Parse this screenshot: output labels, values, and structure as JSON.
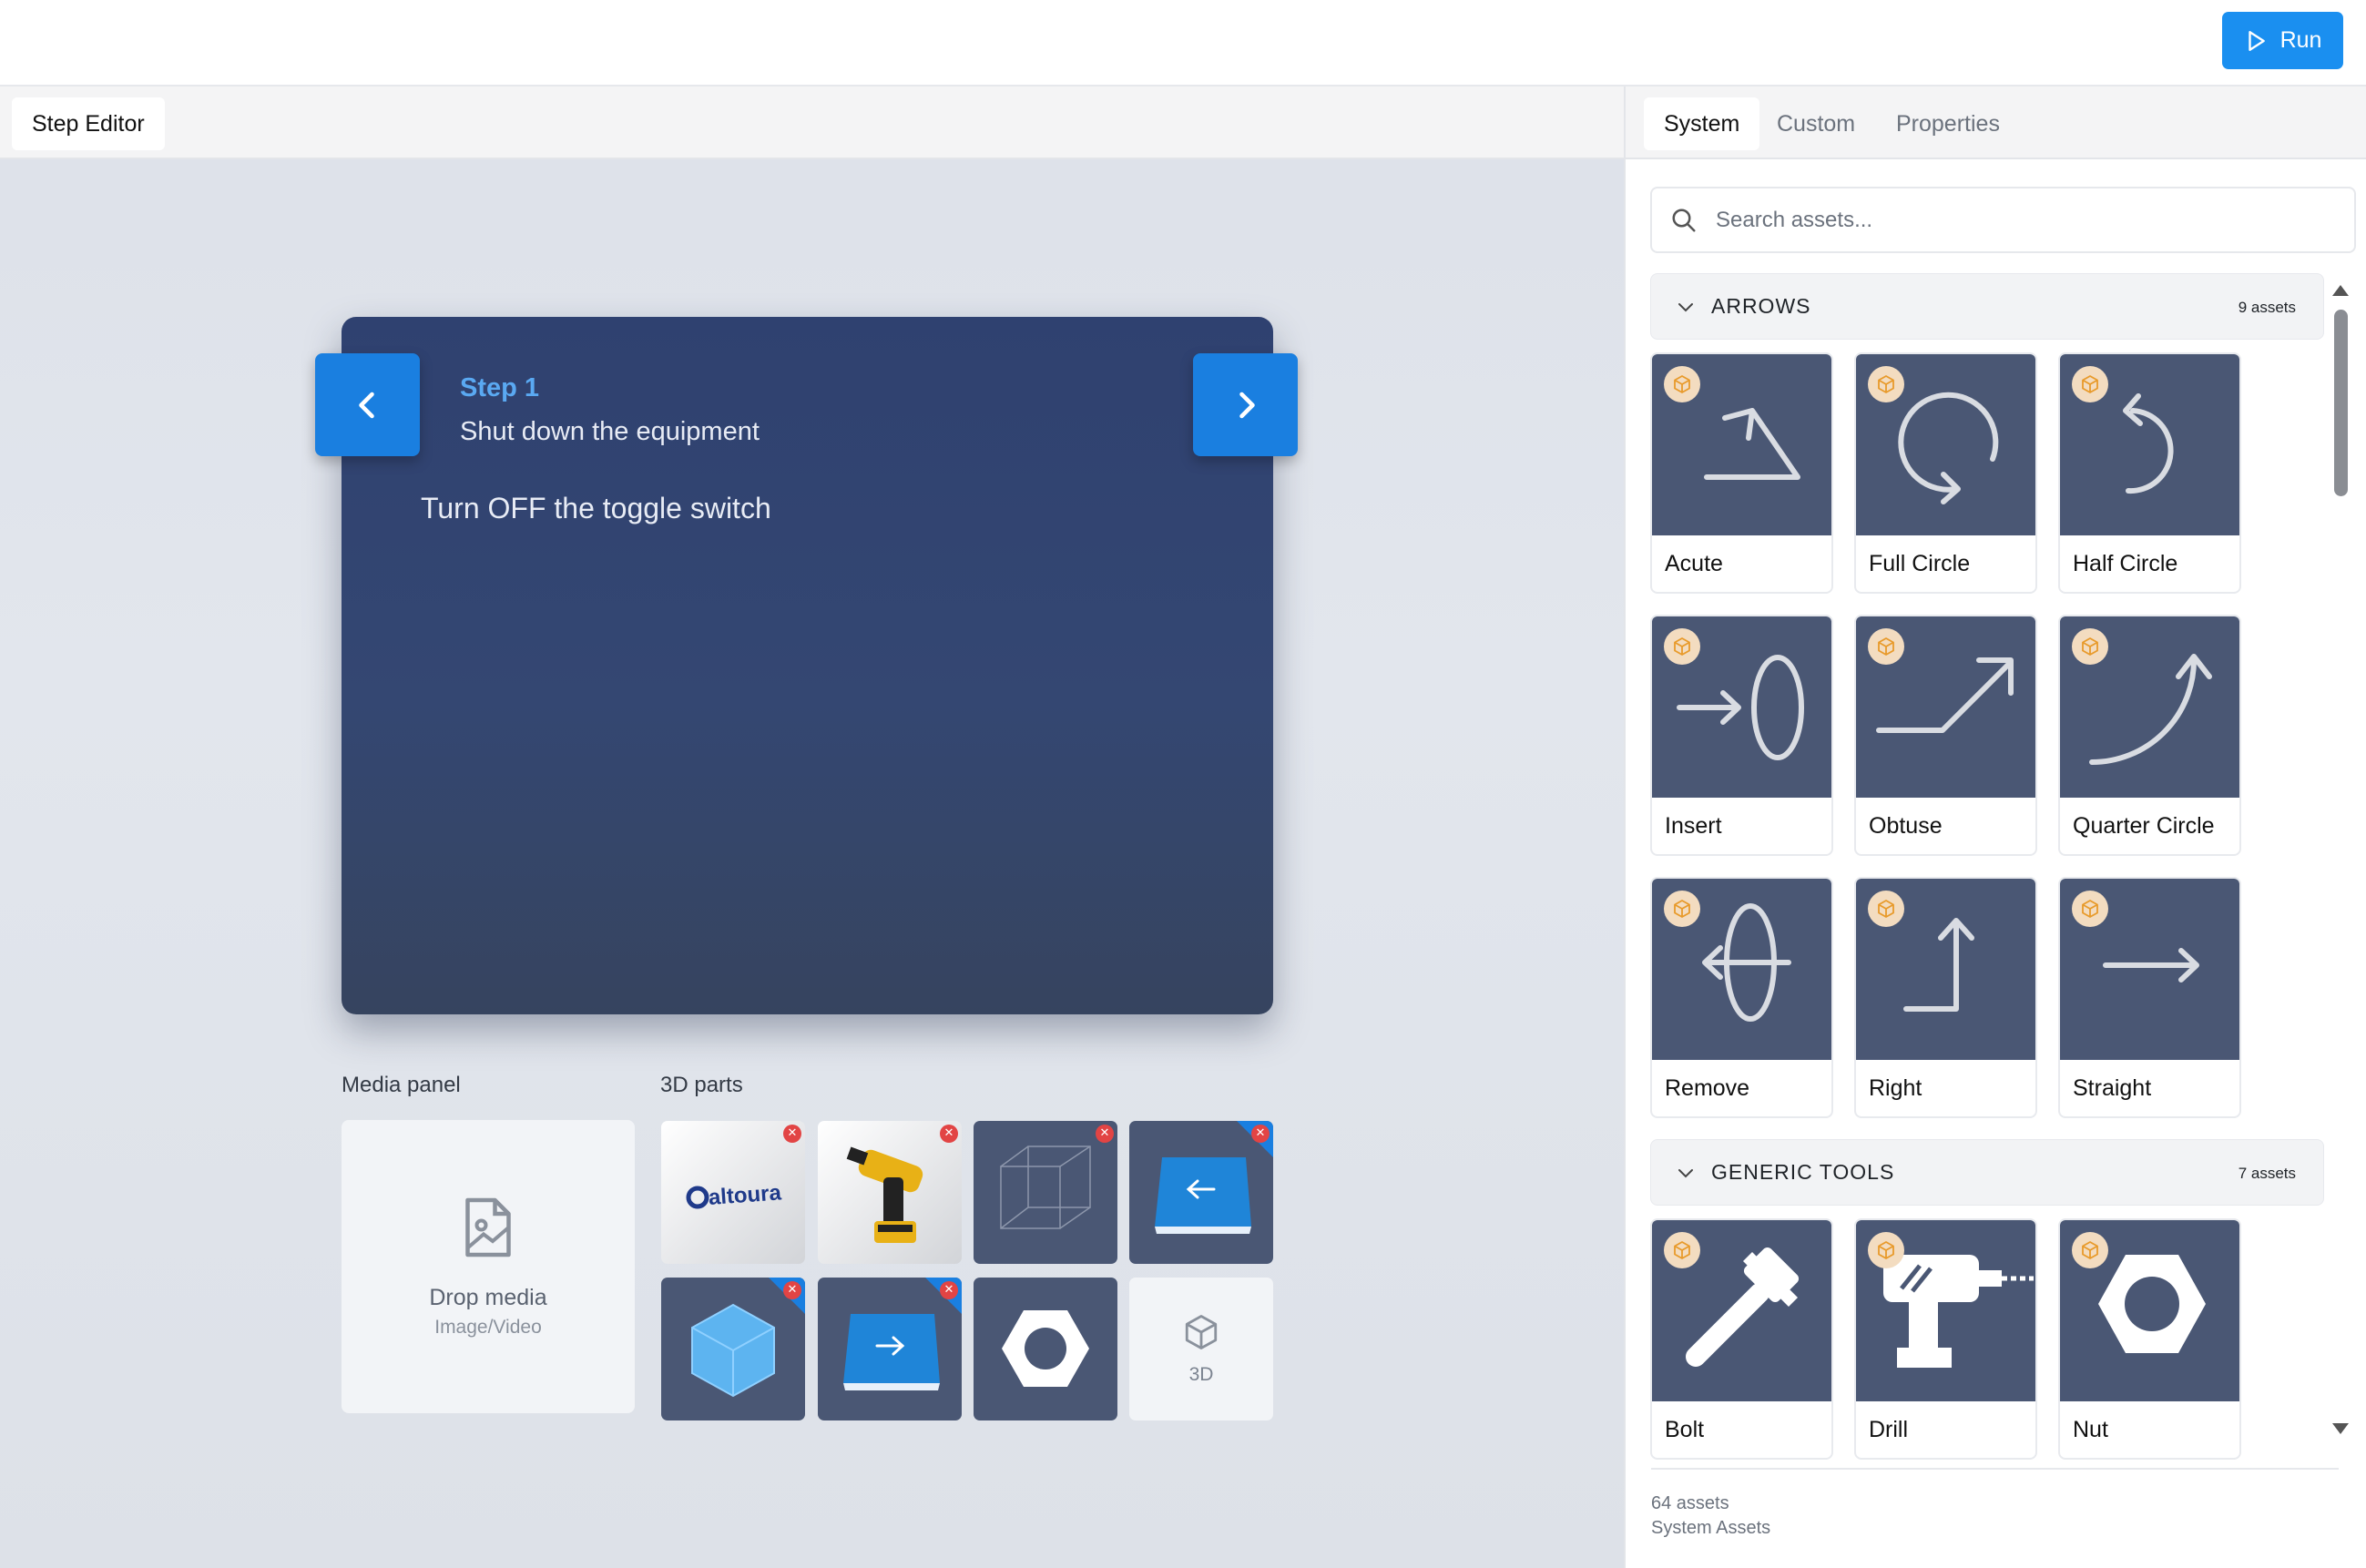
{
  "toolbar": {
    "run_label": "Run",
    "accent": "#1a8ff0"
  },
  "editor": {
    "tab_label": "Step Editor",
    "step": {
      "number_label": "Step 1",
      "title": "Shut down the equipment",
      "instruction": "Turn OFF the toggle switch"
    },
    "media_panel": {
      "label": "Media panel",
      "drop_text": "Drop media",
      "drop_hint": "Image/Video"
    },
    "parts": {
      "label": "3D parts",
      "items": [
        {
          "name": "altoura-logo",
          "text": "altoura"
        },
        {
          "name": "impact-driver"
        },
        {
          "name": "wireframe-cube"
        },
        {
          "name": "left-arrow-tile"
        },
        {
          "name": "blue-cube"
        },
        {
          "name": "right-arrow-tile"
        },
        {
          "name": "hex-nut"
        }
      ],
      "add_label": "3D"
    }
  },
  "assets_panel": {
    "tabs": [
      {
        "label": "System",
        "active": true
      },
      {
        "label": "Custom",
        "active": false
      },
      {
        "label": "Properties",
        "active": false
      }
    ],
    "search_placeholder": "Search assets...",
    "sections": [
      {
        "title": "ARROWS",
        "count": "9 assets",
        "items": [
          "Acute",
          "Full Circle",
          "Half Circle",
          "Insert",
          "Obtuse",
          "Quarter Circle",
          "Remove",
          "Right",
          "Straight"
        ]
      },
      {
        "title": "GENERIC TOOLS",
        "count": "7 assets",
        "items": [
          "Bolt",
          "Drill",
          "Nut"
        ]
      }
    ],
    "footer": {
      "count": "64 assets",
      "source": "System Assets"
    }
  }
}
